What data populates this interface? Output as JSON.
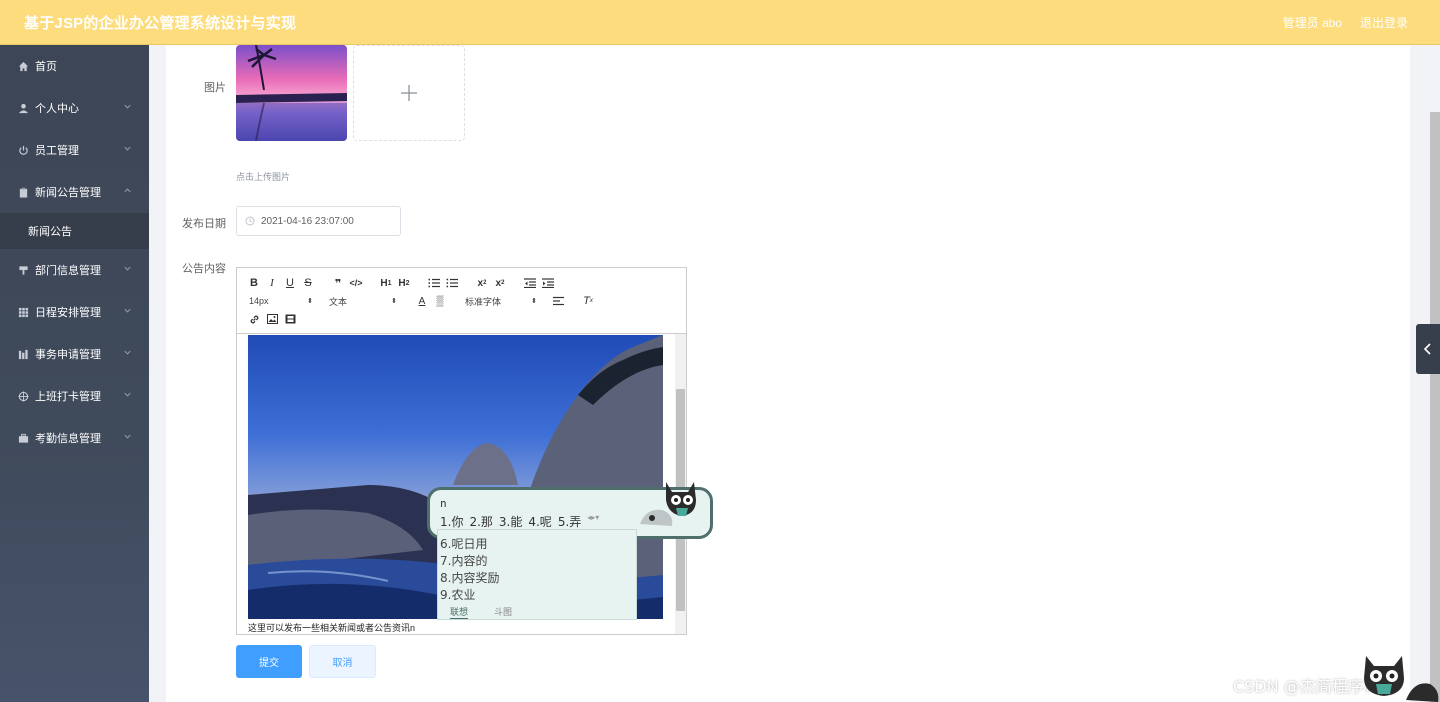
{
  "header": {
    "title": "基于JSP的企业办公管理系统设计与实现",
    "user": "管理员 abo",
    "logout": "退出登录"
  },
  "sidebar": {
    "items": [
      {
        "label": "首页",
        "icon": "home-icon"
      },
      {
        "label": "个人中心",
        "icon": "user-icon"
      },
      {
        "label": "员工管理",
        "icon": "power-icon"
      },
      {
        "label": "新闻公告管理",
        "icon": "clipboard-icon"
      },
      {
        "label": "部门信息管理",
        "icon": "stamp-icon"
      },
      {
        "label": "日程安排管理",
        "icon": "grid-icon"
      },
      {
        "label": "事务申请管理",
        "icon": "bars-icon"
      },
      {
        "label": "上班打卡管理",
        "icon": "target-icon"
      },
      {
        "label": "考勤信息管理",
        "icon": "briefcase-icon"
      }
    ],
    "subitem": "新闻公告"
  },
  "form": {
    "image_label": "图片",
    "upload_tip": "点击上传图片",
    "date_label": "发布日期",
    "date_value": "2021-04-16 23:07:00",
    "content_label": "公告内容",
    "content_text": "这里可以发布一些相关新闻或者公告资讯n",
    "submit": "提交",
    "cancel": "取消"
  },
  "editor": {
    "font_size": "14px",
    "paragraph": "文本",
    "font_family": "标准字体"
  },
  "ime": {
    "input": "n",
    "candidates": [
      "1.你",
      "2.那",
      "3.能",
      "4.呢",
      "5.弄"
    ],
    "more": [
      "6.呢日用",
      "7.内容的",
      "8.内容奖励",
      "9.农业"
    ],
    "tab_active": "联想",
    "tab_other": "斗图"
  },
  "watermark": "CSDN @杰简程序科技",
  "colors": {
    "header": "#fcdc7c",
    "sidebar": "#3d4656",
    "primary": "#409eff"
  }
}
